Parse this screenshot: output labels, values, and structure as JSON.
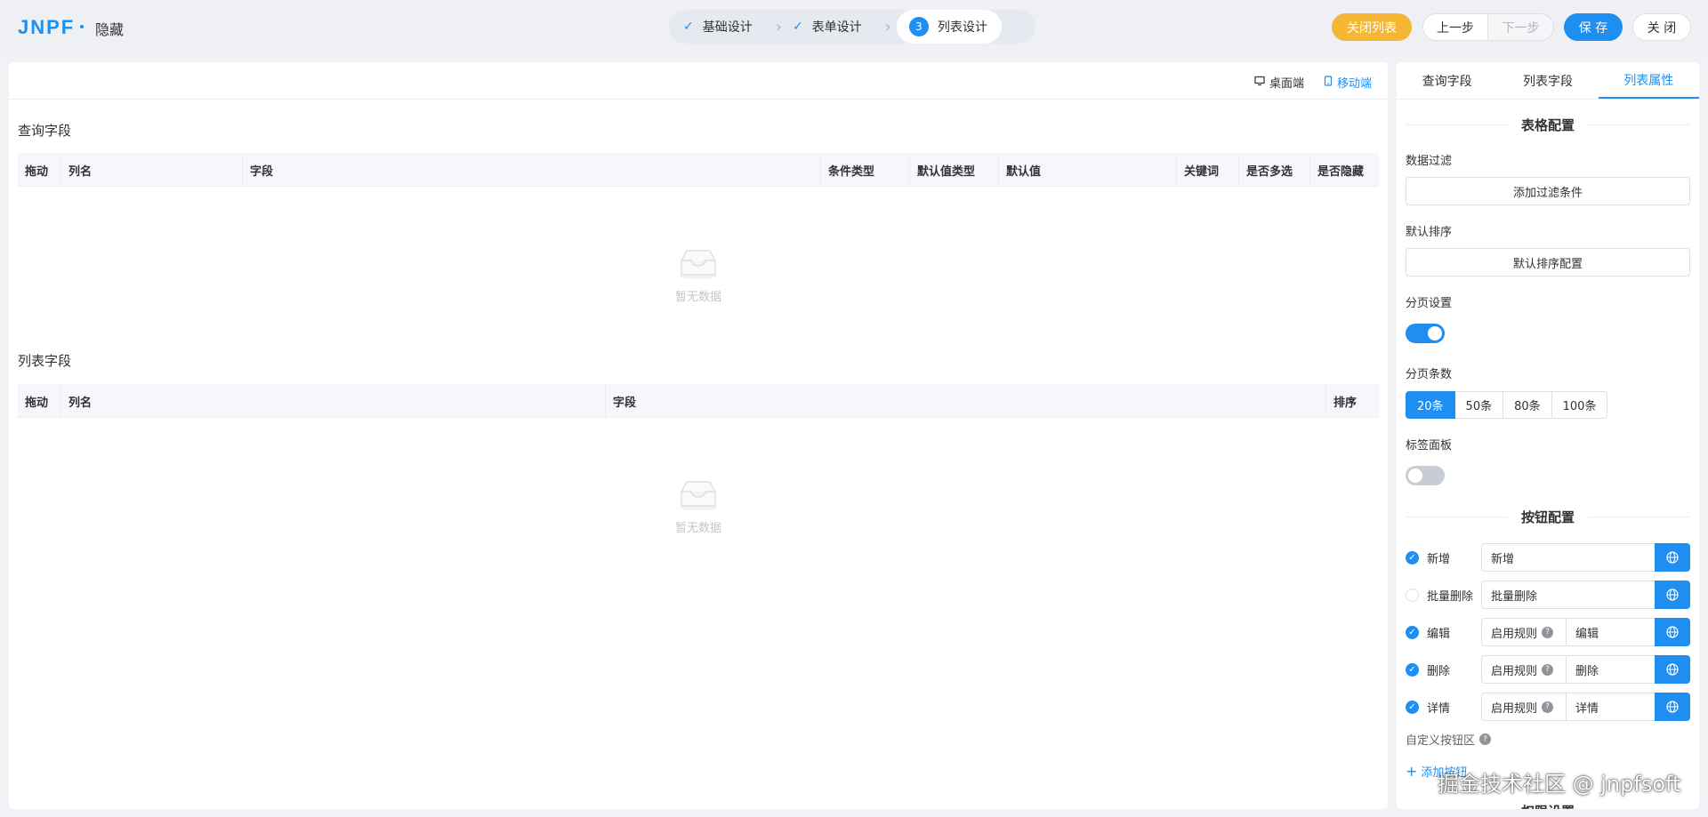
{
  "header": {
    "logo": "JNPF",
    "title": "隐藏",
    "steps": [
      {
        "label": "基础设计",
        "state": "done"
      },
      {
        "label": "表单设计",
        "state": "done"
      },
      {
        "label": "列表设计",
        "state": "active",
        "number": "3"
      }
    ],
    "buttons": {
      "close_list": "关闭列表",
      "prev": "上一步",
      "next": "下一步",
      "save": "保 存",
      "close": "关 闭"
    }
  },
  "viewbar": {
    "desktop": "桌面端",
    "mobile": "移动端"
  },
  "query_section": {
    "title": "查询字段",
    "columns": [
      "拖动",
      "列名",
      "字段",
      "条件类型",
      "默认值类型",
      "默认值",
      "关键词",
      "是否多选",
      "是否隐藏"
    ],
    "empty_text": "暂无数据"
  },
  "list_section": {
    "title": "列表字段",
    "columns": [
      "拖动",
      "列名",
      "字段",
      "排序"
    ],
    "empty_text": "暂无数据"
  },
  "side": {
    "tabs": [
      "查询字段",
      "列表字段",
      "列表属性"
    ],
    "active_tab": 2,
    "table_config": {
      "title": "表格配置",
      "filter_label": "数据过滤",
      "filter_button": "添加过滤条件",
      "sort_label": "默认排序",
      "sort_button": "默认排序配置",
      "paging_label": "分页设置",
      "paging_enabled": true,
      "page_size_label": "分页条数",
      "page_sizes": [
        "20条",
        "50条",
        "80条",
        "100条"
      ],
      "page_size_selected": 0,
      "tab_panel_label": "标签面板",
      "tab_panel_enabled": false
    },
    "button_config": {
      "title": "按钮配置",
      "rows": [
        {
          "label": "新增",
          "checked": true,
          "rule": null,
          "value": "新增"
        },
        {
          "label": "批量删除",
          "checked": false,
          "rule": null,
          "value": "批量删除"
        },
        {
          "label": "编辑",
          "checked": true,
          "rule": "启用规则",
          "value": "编辑"
        },
        {
          "label": "删除",
          "checked": true,
          "rule": "启用规则",
          "value": "删除"
        },
        {
          "label": "详情",
          "checked": true,
          "rule": "启用规则",
          "value": "详情"
        }
      ],
      "custom_label": "自定义按钮区",
      "add_button": "添加按钮"
    },
    "next_section_peek": "权限设置"
  },
  "watermark": "掘金技术社区 @ jnpfsoft",
  "colors": {
    "primary": "#1f8ef1",
    "warning": "#f5b634",
    "background": "#f0f2f5"
  }
}
